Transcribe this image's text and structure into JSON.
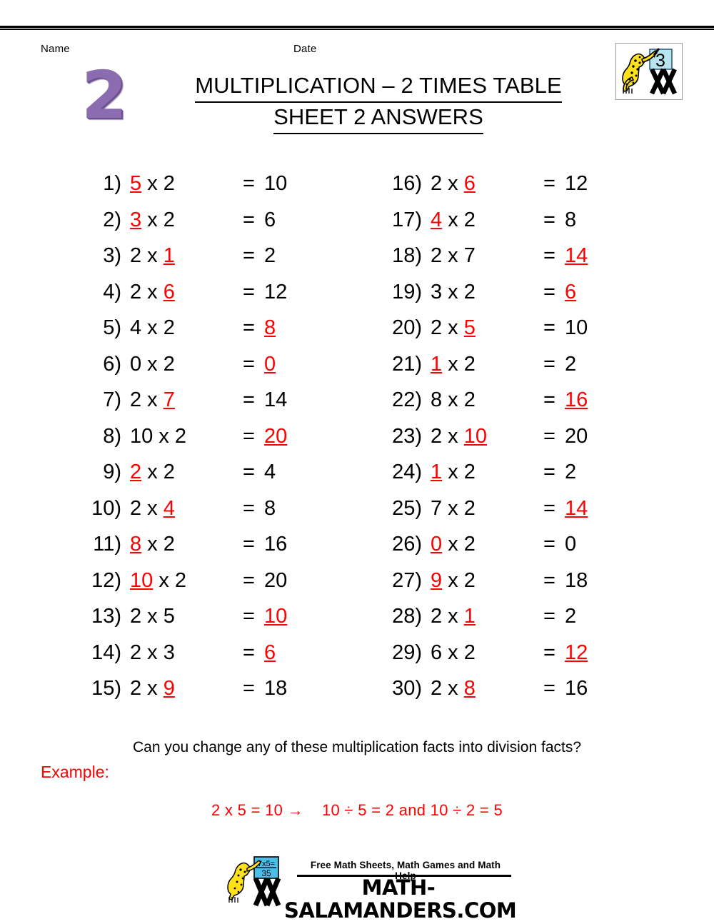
{
  "header": {
    "name_label": "Name",
    "date_label": "Date",
    "big_number": "2",
    "title_line1": "MULTIPLICATION – 2 TIMES TABLE",
    "title_line2": "SHEET 2 ANSWERS"
  },
  "logo": {
    "badge_number": "3"
  },
  "colors": {
    "answer_red": "#fe0000",
    "big_number_purple": "#8b6cb0",
    "badge_blue": "#b8e4f0",
    "salamander_yellow": "#ffe11a"
  },
  "problems_left": [
    {
      "index": "1)",
      "expr_pre": "",
      "expr_red": "5",
      "expr_post": " x 2",
      "eq": "=",
      "ans": "10",
      "ans_red": false
    },
    {
      "index": "2)",
      "expr_pre": "",
      "expr_red": "3",
      "expr_post": " x 2",
      "eq": "=",
      "ans": "6",
      "ans_red": false
    },
    {
      "index": "3)",
      "expr_pre": "2 x ",
      "expr_red": "1",
      "expr_post": "",
      "eq": "=",
      "ans": "2",
      "ans_red": false
    },
    {
      "index": "4)",
      "expr_pre": "2 x ",
      "expr_red": "6",
      "expr_post": "",
      "eq": "=",
      "ans": "12",
      "ans_red": false
    },
    {
      "index": "5)",
      "expr_pre": "4 x 2",
      "expr_red": "",
      "expr_post": "",
      "eq": "=",
      "ans": "8",
      "ans_red": true
    },
    {
      "index": "6)",
      "expr_pre": "0 x 2",
      "expr_red": "",
      "expr_post": "",
      "eq": "=",
      "ans": "0",
      "ans_red": true
    },
    {
      "index": "7)",
      "expr_pre": "2 x ",
      "expr_red": "7",
      "expr_post": "",
      "eq": "=",
      "ans": "14",
      "ans_red": false
    },
    {
      "index": "8)",
      "expr_pre": "10 x 2",
      "expr_red": "",
      "expr_post": "",
      "eq": "=",
      "ans": "20",
      "ans_red": true
    },
    {
      "index": "9)",
      "expr_pre": "",
      "expr_red": "2",
      "expr_post": " x 2",
      "eq": "=",
      "ans": "4",
      "ans_red": false
    },
    {
      "index": "10)",
      "expr_pre": "2 x ",
      "expr_red": "4",
      "expr_post": "",
      "eq": "=",
      "ans": "8",
      "ans_red": false
    },
    {
      "index": "11)",
      "expr_pre": "",
      "expr_red": "8",
      "expr_post": " x 2",
      "eq": "=",
      "ans": "16",
      "ans_red": false
    },
    {
      "index": "12)",
      "expr_pre": "",
      "expr_red": "10",
      "expr_post": " x 2",
      "eq": "=",
      "ans": "20",
      "ans_red": false
    },
    {
      "index": "13)",
      "expr_pre": "2 x 5",
      "expr_red": "",
      "expr_post": "",
      "eq": "=",
      "ans": "10",
      "ans_red": true
    },
    {
      "index": "14)",
      "expr_pre": "2 x 3",
      "expr_red": "",
      "expr_post": "",
      "eq": "=",
      "ans": "6",
      "ans_red": true
    },
    {
      "index": "15)",
      "expr_pre": "2 x ",
      "expr_red": "9",
      "expr_post": "",
      "eq": "=",
      "ans": "18",
      "ans_red": false
    }
  ],
  "problems_right": [
    {
      "index": "16)",
      "expr_pre": "2 x ",
      "expr_red": "6",
      "expr_post": "",
      "eq": "=",
      "ans": "12",
      "ans_red": false
    },
    {
      "index": "17)",
      "expr_pre": "",
      "expr_red": "4",
      "expr_post": " x 2",
      "eq": "=",
      "ans": "8",
      "ans_red": false
    },
    {
      "index": "18)",
      "expr_pre": "2 x 7",
      "expr_red": "",
      "expr_post": "",
      "eq": "=",
      "ans": "14",
      "ans_red": true
    },
    {
      "index": "19)",
      "expr_pre": "3 x 2",
      "expr_red": "",
      "expr_post": "",
      "eq": "=",
      "ans": "6",
      "ans_red": true
    },
    {
      "index": "20)",
      "expr_pre": "2 x ",
      "expr_red": "5",
      "expr_post": "",
      "eq": "=",
      "ans": "10",
      "ans_red": false
    },
    {
      "index": "21)",
      "expr_pre": "",
      "expr_red": "1",
      "expr_post": " x 2",
      "eq": "=",
      "ans": "2",
      "ans_red": false
    },
    {
      "index": "22)",
      "expr_pre": "8 x 2",
      "expr_red": "",
      "expr_post": "",
      "eq": "=",
      "ans": "16",
      "ans_red": true
    },
    {
      "index": "23)",
      "expr_pre": "2 x ",
      "expr_red": "10",
      "expr_post": "",
      "eq": "=",
      "ans": "20",
      "ans_red": false
    },
    {
      "index": "24)",
      "expr_pre": "",
      "expr_red": "1",
      "expr_post": " x 2",
      "eq": "=",
      "ans": "2",
      "ans_red": false
    },
    {
      "index": "25)",
      "expr_pre": "7 x 2",
      "expr_red": "",
      "expr_post": "",
      "eq": "=",
      "ans": "14",
      "ans_red": true
    },
    {
      "index": "26)",
      "expr_pre": "",
      "expr_red": "0",
      "expr_post": " x 2",
      "eq": "=",
      "ans": "0",
      "ans_red": false
    },
    {
      "index": "27)",
      "expr_pre": "",
      "expr_red": "9",
      "expr_post": " x 2",
      "eq": "=",
      "ans": "18",
      "ans_red": false
    },
    {
      "index": "28)",
      "expr_pre": "2 x ",
      "expr_red": "1",
      "expr_post": "",
      "eq": "=",
      "ans": "2",
      "ans_red": false
    },
    {
      "index": "29)",
      "expr_pre": "6 x 2",
      "expr_red": "",
      "expr_post": "",
      "eq": "=",
      "ans": "12",
      "ans_red": true
    },
    {
      "index": "30)",
      "expr_pre": "2 x ",
      "expr_red": "8",
      "expr_post": "",
      "eq": "=",
      "ans": "16",
      "ans_red": false
    }
  ],
  "footer": {
    "question": "Can you change any of these multiplication facts into division facts?",
    "example_label": "Example:",
    "example_part1": "2 x 5 = 10 →",
    "example_part2": "10 ÷ 5 = 2 and 10 ÷ 2 = 5"
  },
  "brand": {
    "tagline": "Free Math Sheets, Math Games and Math Help",
    "url": "MATH-SALAMANDERS.COM",
    "logo_sign_line1": "7x5=",
    "logo_sign_line2": "35"
  }
}
